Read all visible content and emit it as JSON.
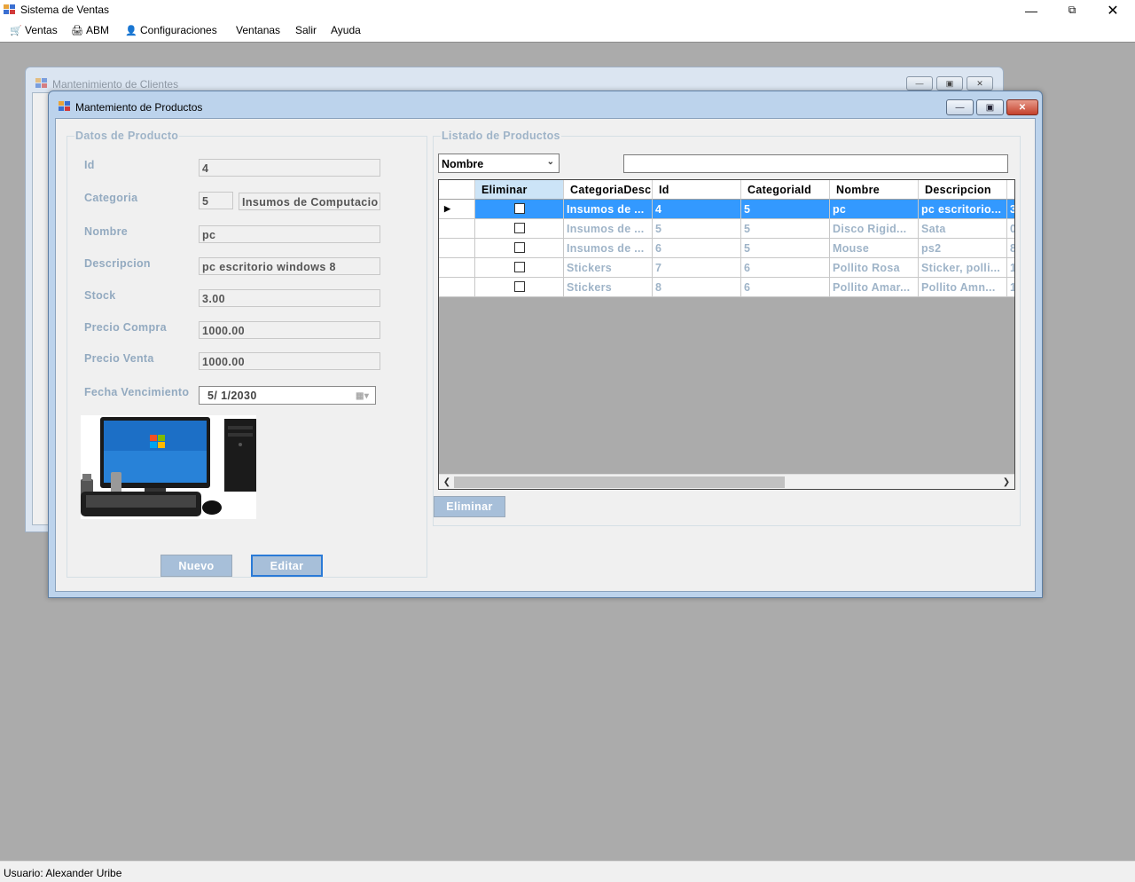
{
  "app": {
    "title": "Sistema de Ventas",
    "colors": {
      "mdi_background": "#ababab",
      "window_frame": "#bcd3ec",
      "selection": "#3399ff",
      "label_text": "#93aac0"
    }
  },
  "menu": [
    {
      "label": "Ventas",
      "icon": "cart-icon"
    },
    {
      "label": "ABM",
      "icon": "printer-icon"
    },
    {
      "label": "Configuraciones",
      "icon": "user-gear-icon"
    },
    {
      "label": "Ventanas",
      "icon": ""
    },
    {
      "label": "Salir",
      "icon": ""
    },
    {
      "label": "Ayuda",
      "icon": ""
    }
  ],
  "clientes_window": {
    "title": "Mantenimiento de Clientes"
  },
  "productos_window": {
    "title": "Mantemiento de Productos",
    "datos": {
      "group_title": "Datos de Producto",
      "id_label": "Id",
      "id_value": "4",
      "categoria_label": "Categoria",
      "categoria_id": "5",
      "categoria_desc": "Insumos de Computacio",
      "nombre_label": "Nombre",
      "nombre_value": "pc",
      "descripcion_label": "Descripcion",
      "descripcion_value": "pc escritorio windows 8",
      "stock_label": "Stock",
      "stock_value": "3.00",
      "precio_compra_label": "Precio Compra",
      "precio_compra_value": "1000.00",
      "precio_venta_label": "Precio Venta",
      "precio_venta_value": "1000.00",
      "fecha_label": "Fecha Vencimiento",
      "fecha_value": "5/  1/2030",
      "nuevo_label": "Nuevo",
      "editar_label": "Editar"
    },
    "listado": {
      "group_title": "Listado de Productos",
      "filter_selected": "Nombre",
      "search_value": "",
      "columns": [
        "Eliminar",
        "CategoriaDesc",
        "Id",
        "CategoriaId",
        "Nombre",
        "Descripcion"
      ],
      "rows": [
        {
          "categoria": "Insumos de ...",
          "id": "4",
          "categoria_id": "5",
          "nombre": "pc",
          "descripcion": "pc escritorio...",
          "extra": "3",
          "selected": true
        },
        {
          "categoria": "Insumos de ...",
          "id": "5",
          "categoria_id": "5",
          "nombre": "Disco Rigid...",
          "descripcion": "Sata",
          "extra": "0",
          "selected": false
        },
        {
          "categoria": "Insumos de ...",
          "id": "6",
          "categoria_id": "5",
          "nombre": "Mouse",
          "descripcion": "ps2",
          "extra": "8",
          "selected": false
        },
        {
          "categoria": "Stickers",
          "id": "7",
          "categoria_id": "6",
          "nombre": "Pollito Rosa",
          "descripcion": "Sticker, polli...",
          "extra": "1",
          "selected": false
        },
        {
          "categoria": "Stickers",
          "id": "8",
          "categoria_id": "6",
          "nombre": "Pollito Amar...",
          "descripcion": "Pollito Amn...",
          "extra": "1",
          "selected": false
        }
      ],
      "eliminar_label": "Eliminar"
    }
  },
  "status": {
    "text": "Usuario: Alexander Uribe"
  }
}
